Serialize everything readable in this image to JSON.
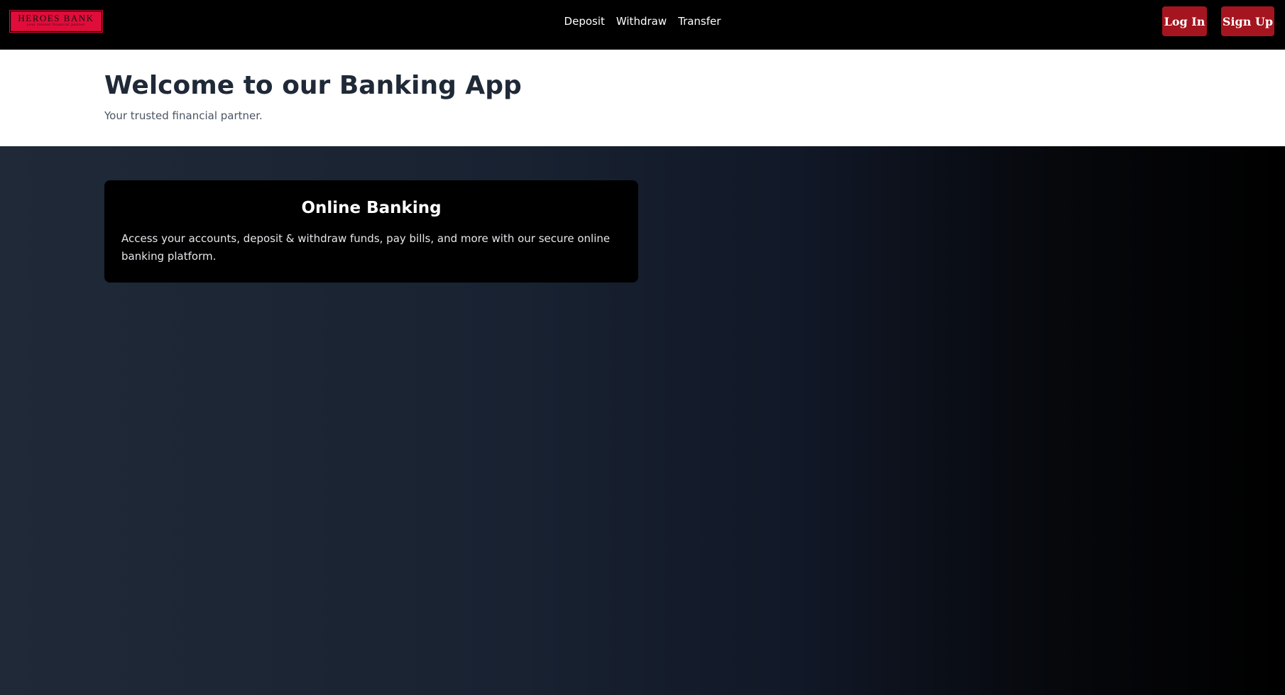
{
  "colors": {
    "nav_background": "#000000",
    "logo_red": "#e00d3a",
    "button_red": "#a4151f",
    "hero_background": "#ffffff",
    "title_text": "#1f2937",
    "main_gradient_start": "#1f2937",
    "main_gradient_end": "#000000",
    "card_background": "#000000"
  },
  "navbar": {
    "logo": {
      "name": "HEROES BANK",
      "tagline": "your trusted financial partner"
    },
    "links": [
      {
        "label": "Deposit"
      },
      {
        "label": "Withdraw"
      },
      {
        "label": "Transfer"
      }
    ],
    "login_label": "Log In",
    "signup_label": "Sign Up"
  },
  "hero": {
    "title": "Welcome to our Banking App",
    "subtitle": "Your trusted financial partner."
  },
  "main": {
    "card": {
      "title": "Online Banking",
      "text": "Access your accounts, deposit & withdraw funds, pay bills, and more with our secure online banking platform."
    }
  }
}
